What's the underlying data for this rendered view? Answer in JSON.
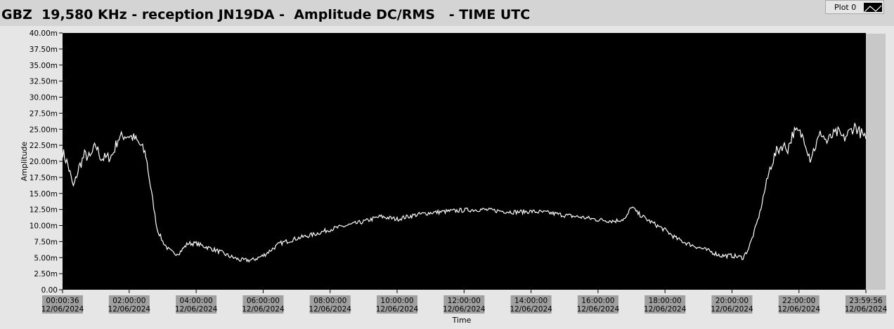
{
  "title": "GBZ  19,580 KHz - reception JN19DA -  Amplitude DC/RMS   - TIME UTC",
  "legend": {
    "label": "Plot 0"
  },
  "colors": {
    "plot_bg": "#000000",
    "trace": "#ffffff",
    "panel": "#e6e6e6",
    "page": "#d4d4d4",
    "label_box": "#a0a0a0"
  },
  "chart_data": {
    "type": "line",
    "title": "GBZ  19,580 KHz - reception JN19DA -  Amplitude DC/RMS   - TIME UTC",
    "xlabel": "Time",
    "ylabel": "Amplitude",
    "xlim": [
      "2024-06-12T00:00:36",
      "2024-06-12T23:59:56"
    ],
    "ylim": [
      0,
      40
    ],
    "y_unit_suffix": "m",
    "y_ticks": [
      "0.00",
      "2.50m",
      "5.00m",
      "7.50m",
      "10.00m",
      "12.50m",
      "15.00m",
      "17.50m",
      "20.00m",
      "22.50m",
      "25.00m",
      "27.50m",
      "30.00m",
      "32.50m",
      "35.00m",
      "37.50m",
      "40.00m"
    ],
    "x_ticks": [
      {
        "time": "00:00:36",
        "date": "12/06/2024"
      },
      {
        "time": "02:00:00",
        "date": "12/06/2024"
      },
      {
        "time": "04:00:00",
        "date": "12/06/2024"
      },
      {
        "time": "06:00:00",
        "date": "12/06/2024"
      },
      {
        "time": "08:00:00",
        "date": "12/06/2024"
      },
      {
        "time": "10:00:00",
        "date": "12/06/2024"
      },
      {
        "time": "12:00:00",
        "date": "12/06/2024"
      },
      {
        "time": "14:00:00",
        "date": "12/06/2024"
      },
      {
        "time": "16:00:00",
        "date": "12/06/2024"
      },
      {
        "time": "18:00:00",
        "date": "12/06/2024"
      },
      {
        "time": "20:00:00",
        "date": "12/06/2024"
      },
      {
        "time": "22:00:00",
        "date": "12/06/2024"
      },
      {
        "time": "23:59:56",
        "date": "12/06/2024"
      }
    ],
    "grid": false,
    "legend": "top-right",
    "series": [
      {
        "name": "Plot 0",
        "x": [
          "00:00:36",
          "00:10:00",
          "00:20:00",
          "00:30:00",
          "00:40:00",
          "00:50:00",
          "01:00:00",
          "01:10:00",
          "01:20:00",
          "01:30:00",
          "01:40:00",
          "01:50:00",
          "02:00:00",
          "02:10:00",
          "02:20:00",
          "02:30:00",
          "02:40:00",
          "02:50:00",
          "03:00:00",
          "03:10:00",
          "03:20:00",
          "03:30:00",
          "03:45:00",
          "04:00:00",
          "04:20:00",
          "04:40:00",
          "05:00:00",
          "05:20:00",
          "05:40:00",
          "06:00:00",
          "06:30:00",
          "07:00:00",
          "07:30:00",
          "08:00:00",
          "08:30:00",
          "09:00:00",
          "09:30:00",
          "10:00:00",
          "10:30:00",
          "11:00:00",
          "11:30:00",
          "12:00:00",
          "12:30:00",
          "13:00:00",
          "13:30:00",
          "14:00:00",
          "14:30:00",
          "15:00:00",
          "15:30:00",
          "16:00:00",
          "16:30:00",
          "16:50:00",
          "17:00:00",
          "17:10:00",
          "17:30:00",
          "18:00:00",
          "18:20:00",
          "18:40:00",
          "19:00:00",
          "19:20:00",
          "19:40:00",
          "20:00:00",
          "20:20:00",
          "20:30:00",
          "20:40:00",
          "20:50:00",
          "21:00:00",
          "21:10:00",
          "21:20:00",
          "21:30:00",
          "21:40:00",
          "21:50:00",
          "22:00:00",
          "22:10:00",
          "22:20:00",
          "22:30:00",
          "22:40:00",
          "22:50:00",
          "23:00:00",
          "23:10:00",
          "23:20:00",
          "23:30:00",
          "23:40:00",
          "23:50:00",
          "23:59:56"
        ],
        "values": [
          21.5,
          19.5,
          16,
          19,
          21,
          20.5,
          22.5,
          20.5,
          20.5,
          21,
          23.5,
          24,
          24,
          23.5,
          22.5,
          21,
          15,
          9.5,
          7.5,
          6.3,
          5.6,
          5.8,
          7.2,
          7.2,
          6.6,
          6.0,
          5.2,
          4.6,
          4.6,
          5.3,
          7.2,
          8.0,
          8.6,
          9.4,
          10.0,
          10.6,
          11.4,
          11.0,
          11.6,
          12.0,
          12.2,
          12.4,
          12.5,
          12.3,
          12.1,
          12.2,
          12.0,
          11.6,
          11.3,
          10.9,
          10.7,
          11.1,
          13.0,
          12.0,
          10.8,
          9.3,
          8.0,
          7.2,
          6.6,
          6.0,
          5.3,
          5.3,
          5.0,
          6.5,
          9.0,
          12.0,
          16.0,
          19.5,
          21.5,
          22.5,
          22.0,
          24.5,
          24.5,
          23.5,
          20.5,
          22.5,
          24.5,
          23.0,
          24.0,
          24.5,
          23.5,
          24.5,
          25.5,
          24.5,
          23.5
        ]
      }
    ]
  }
}
